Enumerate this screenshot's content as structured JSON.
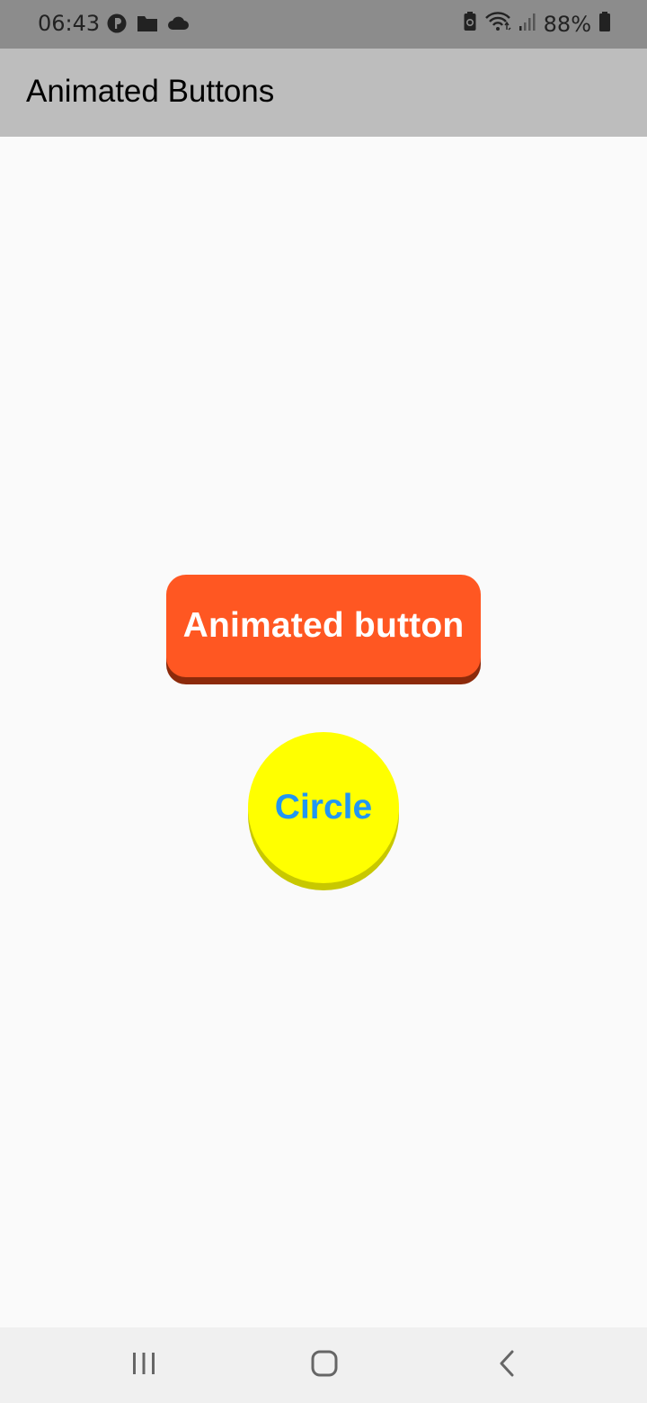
{
  "status_bar": {
    "time": "06:43",
    "battery_percent": "88%"
  },
  "app_bar": {
    "title": "Animated Buttons"
  },
  "buttons": {
    "animated_label": "Animated button",
    "circle_label": "Circle"
  },
  "colors": {
    "status_bar_bg": "#8c8c8c",
    "app_bar_bg": "#bdbdbd",
    "page_bg": "#fafafa",
    "animated_button_bg": "#ff5722",
    "animated_button_shadow": "#8c2a0b",
    "circle_bg": "#ffff00",
    "circle_shadow": "#c8c800",
    "circle_text": "#2196f3",
    "nav_bar_bg": "#f0f0f0"
  },
  "icons": {
    "status_left": [
      "app-notification-icon",
      "folder-icon",
      "cloud-icon"
    ],
    "status_right": [
      "battery-saver-icon",
      "wifi-icon",
      "signal-icon",
      "battery-icon"
    ],
    "nav": [
      "recents-icon",
      "home-icon",
      "back-icon"
    ]
  }
}
